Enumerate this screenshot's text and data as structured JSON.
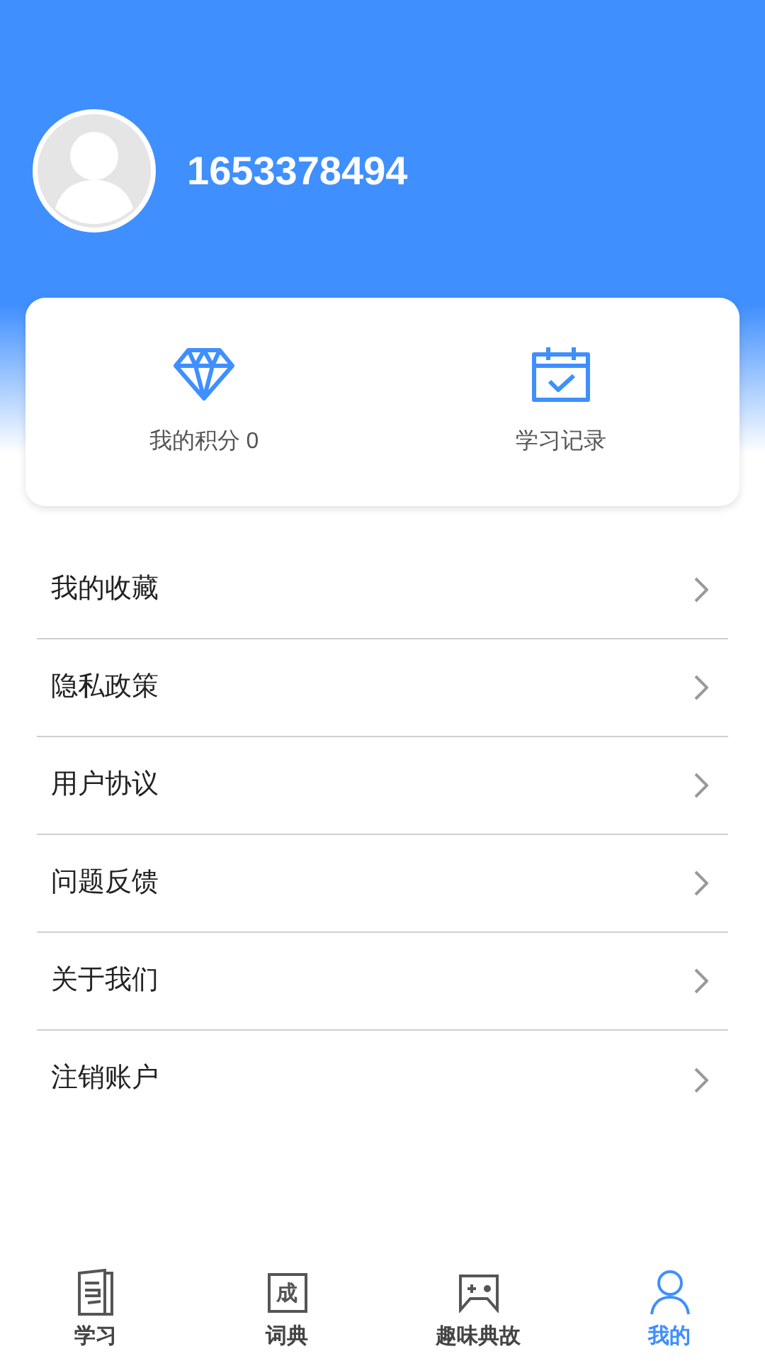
{
  "profile": {
    "user_id": "1653378494"
  },
  "quick_actions": [
    {
      "kind": "points",
      "label": "我的积分 0"
    },
    {
      "kind": "history",
      "label": "学习记录"
    }
  ],
  "menu": [
    "我的收藏",
    "隐私政策",
    "用户协议",
    "问题反馈",
    "关于我们",
    "注销账户"
  ],
  "tabs": [
    {
      "kind": "book",
      "label": "学习",
      "selected": false
    },
    {
      "kind": "char",
      "icon_char": "成",
      "label": "词典",
      "selected": false
    },
    {
      "kind": "game",
      "label": "趣味典故",
      "selected": false
    },
    {
      "kind": "person",
      "label": "我的",
      "selected": true
    }
  ]
}
